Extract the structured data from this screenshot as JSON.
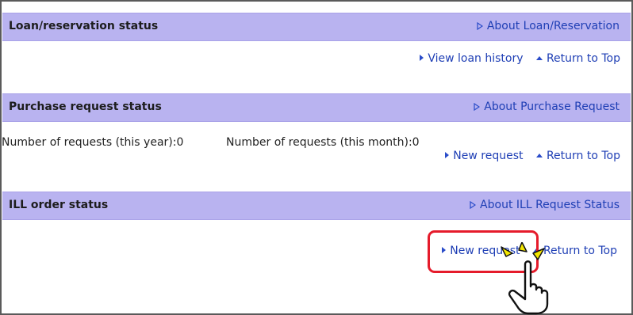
{
  "sections": [
    {
      "title": "Loan/reservation status",
      "about": "About Loan/Reservation",
      "links": [
        "View loan history",
        "Return to Top"
      ]
    },
    {
      "title": "Purchase request status",
      "about": "About Purchase Request",
      "counts": {
        "year": "Number of requests (this year):0",
        "month": "Number of requests (this month):0"
      },
      "links": [
        "New request",
        "Return to Top"
      ]
    },
    {
      "title": "ILL order status",
      "about": "About ILL Request Status",
      "links": [
        "New request",
        "Return to Top"
      ]
    }
  ],
  "colors": {
    "header_bg": "#b9b3f0",
    "link": "#1f3fb5",
    "highlight": "#e51b2b"
  },
  "icons": {
    "about": "outline-triangle-right-icon",
    "link": "solid-triangle-right-icon",
    "top": "triangle-up-icon",
    "pointer": "pointing-hand-icon"
  }
}
